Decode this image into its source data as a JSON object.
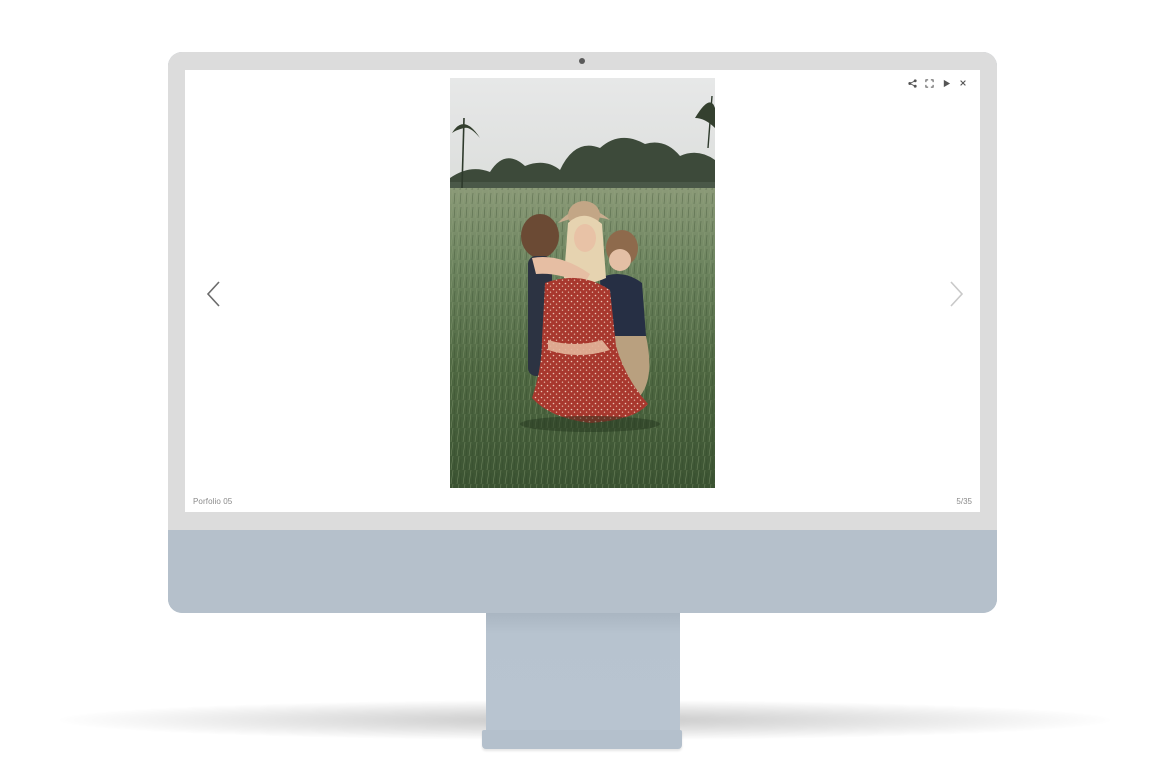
{
  "lightbox": {
    "caption": "Porfolio 05",
    "counter": "5/35",
    "toolbar": {
      "share_icon": "share-icon",
      "fullscreen_icon": "fullscreen-icon",
      "play_icon": "play-icon",
      "close_icon": "close-icon"
    },
    "nav": {
      "prev_icon": "chevron-left-icon",
      "next_icon": "chevron-right-icon"
    },
    "photo": {
      "subject": "mother-hugging-two-children-in-grass-field"
    }
  },
  "colors": {
    "monitor_body": "#b5c0cb",
    "bezel": "#dcdcdc",
    "screen_bg": "#ffffff",
    "ui_icon": "#555555",
    "caption_text": "#8a8a8a"
  }
}
